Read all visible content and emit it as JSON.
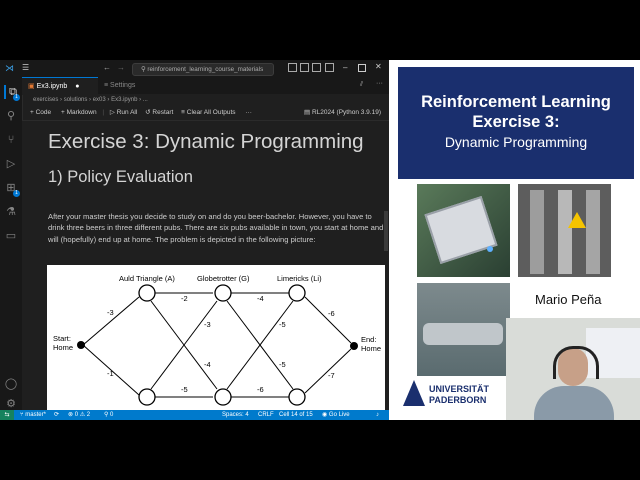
{
  "vscode": {
    "nav": {
      "back": "←",
      "forward": "→"
    },
    "search_placeholder": "reinforcement_learning_course_materials",
    "tabs": [
      {
        "label": "Ex3.ipynb",
        "modified_marker": "●"
      },
      {
        "label": "Settings"
      }
    ],
    "breadcrumb": [
      "exercises",
      "solutions",
      "ex03",
      "Ex3.ipynb",
      "..."
    ],
    "toolbar": {
      "code": "+ Code",
      "markdown": "+ Markdown",
      "run_all": "Run All",
      "restart": "Restart",
      "clear": "Clear All Outputs",
      "more": "···",
      "kernel": "RL2024 (Python 3.9.19)"
    },
    "notebook": {
      "h1": "Exercise 3: Dynamic Programming",
      "h2": "1) Policy Evaluation",
      "paragraph": "After your master thesis you decide to study on and do you beer-bachelor. However, you have to drink three beers in three different pubs. There are six pubs available in town, you start at home and will (hopefully) end up at home. The problem is depicted in the following picture:"
    },
    "graph": {
      "nodes": [
        {
          "id": "start",
          "label": "Start:\nHome"
        },
        {
          "id": "A_top",
          "label": "Auld Triangle (A)"
        },
        {
          "id": "G_top",
          "label": "Globetrotter (G)"
        },
        {
          "id": "L_top",
          "label": "Limericks (Li)"
        },
        {
          "id": "end",
          "label": "End:\nHome"
        }
      ],
      "edges": [
        {
          "label": "-3"
        },
        {
          "label": "-1"
        },
        {
          "label": "-2"
        },
        {
          "label": "-3"
        },
        {
          "label": "-4"
        },
        {
          "label": "-5"
        },
        {
          "label": "-4"
        },
        {
          "label": "-5"
        },
        {
          "label": "-5"
        },
        {
          "label": "-6"
        },
        {
          "label": "-6"
        },
        {
          "label": "-7"
        }
      ]
    },
    "status": {
      "branch": "master*",
      "sync": "⟳",
      "problems": "⊗ 0 ⚠ 2",
      "ports": "⚲ 0",
      "spaces": "Spaces: 4",
      "eol": "CRLF",
      "cell": "Cell 14 of 15",
      "golive": "Go Live"
    },
    "activity_badges": [
      "1",
      "1"
    ],
    "accent": "#007acc"
  },
  "slide": {
    "title_line1": "Reinforcement Learning",
    "title_line2": "Exercise 3:",
    "subtitle": "Dynamic Programming",
    "presenter": "Mario Peña",
    "university_line1": "UNIVERSITÄT",
    "university_line2": "PADERBORN",
    "header_color": "#1a2f6e"
  }
}
